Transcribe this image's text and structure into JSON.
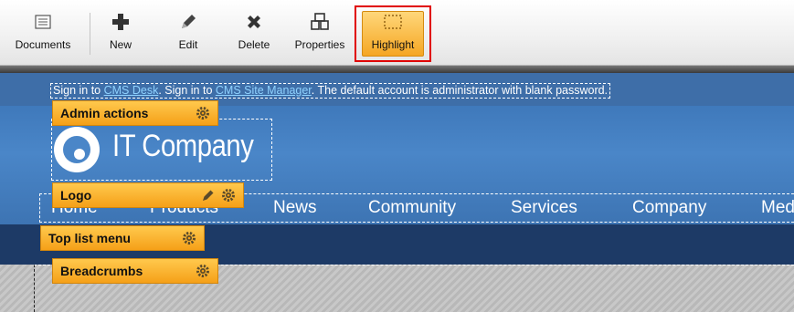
{
  "toolbar": {
    "buttons": [
      {
        "label": "Documents",
        "icon": "documents-icon"
      },
      {
        "label": "New",
        "icon": "plus-icon"
      },
      {
        "label": "Edit",
        "icon": "pencil-icon"
      },
      {
        "label": "Delete",
        "icon": "delete-x-icon"
      },
      {
        "label": "Properties",
        "icon": "properties-icon"
      },
      {
        "label": "Highlight",
        "icon": "highlight-icon"
      }
    ]
  },
  "signin": {
    "prefix": "Sign in to ",
    "cms_desk": "CMS Desk",
    "middle": ". Sign in to ",
    "site_manager": "CMS Site Manager",
    "suffix": ". The default account is administrator with blank password."
  },
  "logo": {
    "text": "IT Company"
  },
  "menu": {
    "items": [
      "Home",
      "Products",
      "News",
      "Community",
      "Services",
      "Company",
      "Med"
    ]
  },
  "webparts": {
    "admin_actions": "Admin actions",
    "logo": "Logo",
    "top_list_menu": "Top list menu",
    "breadcrumbs": "Breadcrumbs"
  },
  "colors": {
    "accent_orange": "#f5a623",
    "highlight_frame": "#e00000",
    "site_blue": "#3e6ea8",
    "site_dark": "#1d3a66",
    "link": "#8fd2ff"
  }
}
